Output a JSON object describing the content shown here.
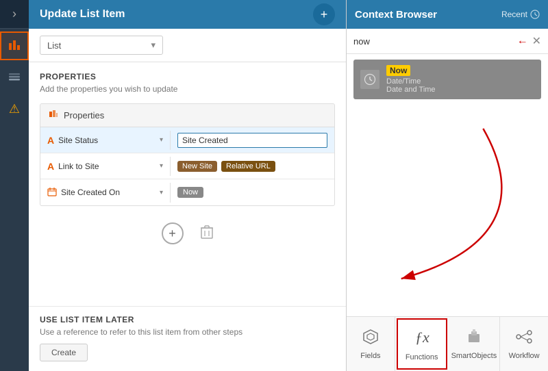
{
  "sidebar": {
    "expand_label": "›",
    "items": [
      {
        "name": "chart-icon",
        "icon": "▦",
        "active": true
      },
      {
        "name": "layers-icon",
        "icon": "⧉",
        "active": false
      },
      {
        "name": "warning-icon",
        "icon": "⚠",
        "active": false
      }
    ]
  },
  "header": {
    "title": "Update List Item",
    "add_button_label": "+"
  },
  "list_dropdown": {
    "placeholder": "List",
    "value": "List"
  },
  "properties_section": {
    "title": "PROPERTIES",
    "description": "Add the properties you wish to update",
    "header_label": "Properties",
    "rows": [
      {
        "field_icon": "A",
        "field_icon_type": "text",
        "field_label": "Site Status",
        "value_type": "text-input",
        "value": "Site Created",
        "active": true
      },
      {
        "field_icon": "A",
        "field_icon_type": "text",
        "field_label": "Link to Site",
        "value_type": "tags",
        "tags": [
          "New Site",
          "Relative URL"
        ],
        "active": false
      },
      {
        "field_icon": "📅",
        "field_icon_type": "date",
        "field_label": "Site Created On",
        "value_type": "now-tag",
        "tag": "Now",
        "active": false
      }
    ],
    "add_button_label": "+",
    "delete_button_label": "🗑"
  },
  "use_section": {
    "title": "USE LIST ITEM LATER",
    "description": "Use a reference to refer to this list item from other steps",
    "create_button_label": "Create"
  },
  "context_browser": {
    "title": "Context Browser",
    "recent_label": "Recent",
    "search_value": "now",
    "search_placeholder": "now",
    "result": {
      "name": "Now",
      "type": "Date/Time",
      "subtype": "Date and Time"
    }
  },
  "bottom_tabs": [
    {
      "label": "Fields",
      "icon": "⬡⬡",
      "active": false
    },
    {
      "label": "Functions",
      "icon": "𝑓𝑥",
      "active": true
    },
    {
      "label": "SmartObjects",
      "icon": "◈",
      "active": false
    },
    {
      "label": "Workflow",
      "icon": "⎇",
      "active": false
    }
  ]
}
